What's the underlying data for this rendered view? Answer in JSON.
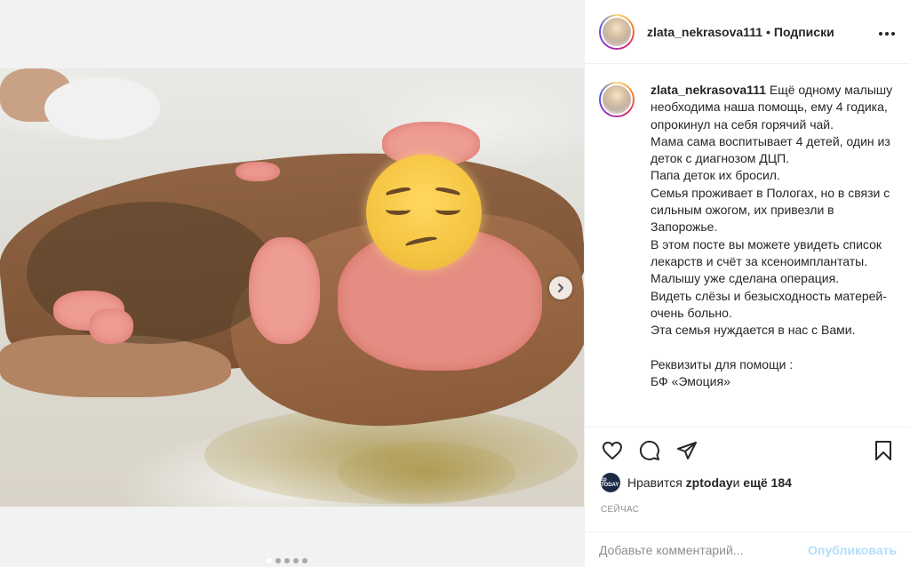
{
  "post": {
    "next_icon": "chevron-right-icon",
    "carousel_dots": 5,
    "carousel_active": 0
  },
  "header": {
    "username": "zlata_nekrasova111",
    "separator": "•",
    "follow_label": "Подписки",
    "more_icon": "more-options-icon",
    "more_label": "..."
  },
  "caption": {
    "username": "zlata_nekrasova111",
    "text": " Ещё одному малышу необходима наша помощь, ему 4 годика, опрокинул на себя горячий чай.\nМама сама воспитывает 4 детей, один из деток с диагнозом ДЦП.\nПапа деток их бросил.\nСемья проживает в Пологах, но в связи с сильным ожогом, их привезли в Запорожье.\nВ этом посте вы можете увидеть список лекарств и счёт за ксеноимплантаты.\nМалышу уже сделана операция.\nВидеть слёзы и безысходность матерей-очень больно.\nЭта семья нуждается в нас с Вами.\n\nРеквизиты для помощи :\nБФ «Эмоция»"
  },
  "actions": {
    "like_icon": "heart-icon",
    "comment_icon": "comment-icon",
    "share_icon": "share-icon",
    "save_icon": "bookmark-icon"
  },
  "likes": {
    "avatar_text": "zp TODAY",
    "prefix": "Нравится ",
    "user": "zptoday",
    "middle": " и ",
    "count": "ещё 184"
  },
  "time": "СЕЙЧАС",
  "comment": {
    "placeholder": "Добавьте комментарий...",
    "publish_label": "Опубликовать"
  },
  "colors": {
    "accent_link": "#b2dffc",
    "text": "#262626",
    "muted": "#8e8e8e"
  }
}
